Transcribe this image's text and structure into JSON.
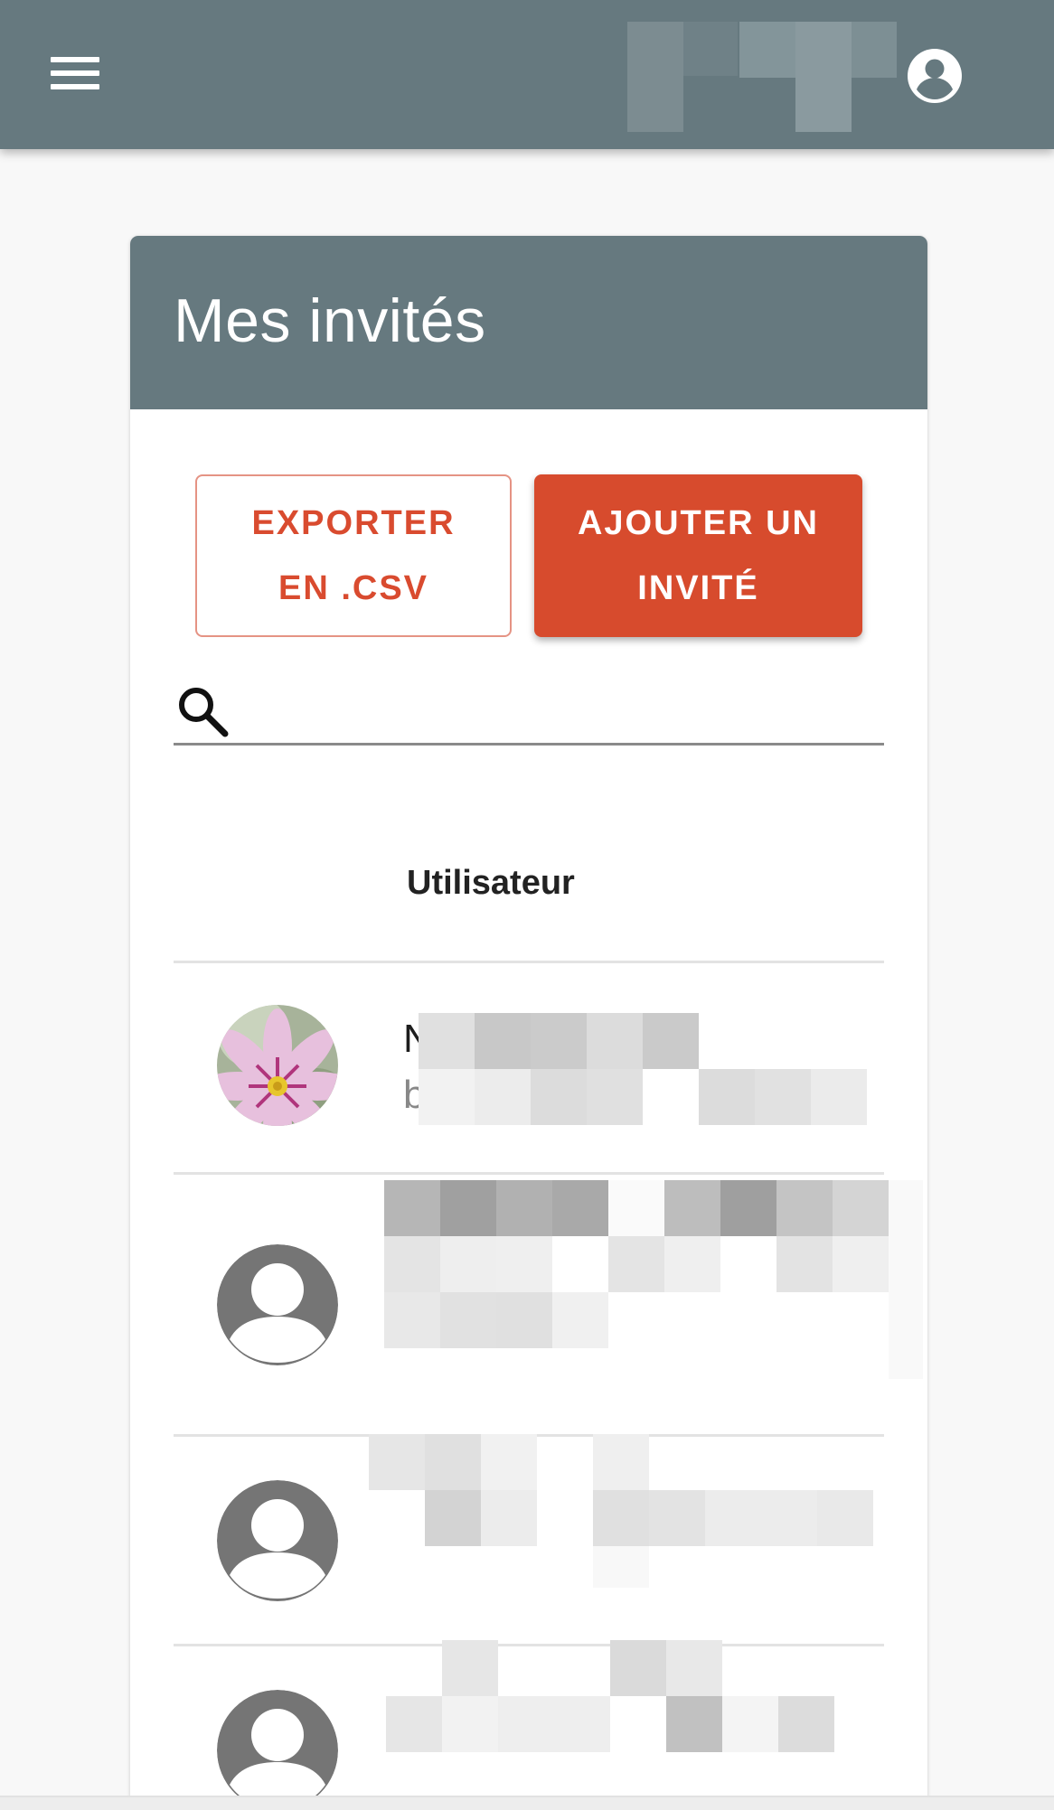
{
  "appbar": {
    "menu_icon": "hamburger-menu-icon",
    "account_icon": "account-circle-icon"
  },
  "card": {
    "title": "Mes invités",
    "export_button": "EXPORTER\nEN .CSV",
    "export_button_lines": [
      "EXPORTER",
      "EN .CSV"
    ],
    "add_button_lines": [
      "AJOUTER UN",
      "INVITÉ"
    ],
    "search": {
      "placeholder": "",
      "value": "",
      "icon": "search-icon"
    },
    "table": {
      "column_header": "Utilisateur",
      "rows": [
        {
          "avatar": "flower-photo",
          "name_visible": "N",
          "email_visible": "b"
        },
        {
          "avatar": "default-user-icon"
        },
        {
          "avatar": "default-user-icon"
        },
        {
          "avatar": "default-user-icon"
        }
      ]
    }
  },
  "colors": {
    "appbar": "#66797f",
    "accent": "#d74b2d",
    "background": "#f8f8f8"
  }
}
